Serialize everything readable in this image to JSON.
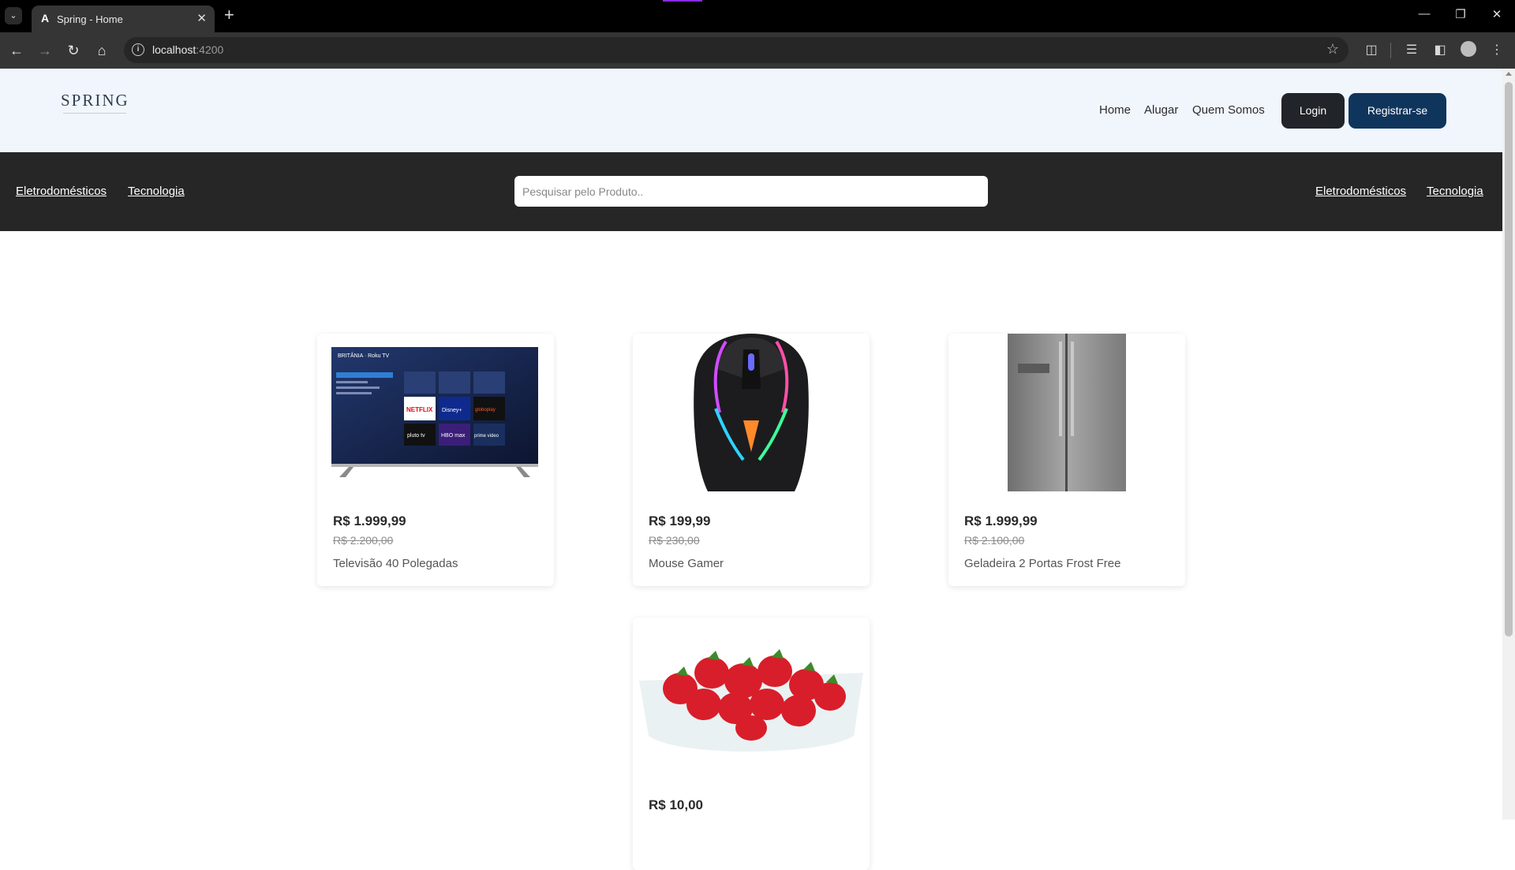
{
  "browser": {
    "tab_title": "Spring - Home",
    "tab_favicon": "A",
    "url_host": "localhost",
    "url_port": ":4200",
    "icons": [
      "tab-list-icon",
      "close-icon",
      "new-tab-icon",
      "minimize-icon",
      "restore-icon",
      "window-close-icon",
      "back-icon",
      "forward-icon",
      "reload-icon",
      "home-icon",
      "site-info-icon",
      "bookmark-star-icon",
      "extensions-icon",
      "media-icon",
      "side-panel-icon",
      "profile-icon",
      "menu-icon"
    ]
  },
  "header": {
    "logo": "SPRING",
    "nav": [
      "Home",
      "Alugar",
      "Quem Somos"
    ],
    "login_label": "Login",
    "register_label": "Registrar-se",
    "colors": {
      "background": "#f1f6fd",
      "login": "#212428",
      "register": "#10355c"
    }
  },
  "category_bar": {
    "left": [
      "Eletrodomésticos",
      "Tecnologia"
    ],
    "right": [
      "Eletrodomésticos",
      "Tecnologia"
    ],
    "search_placeholder": "Pesquisar pelo Produto..",
    "colors": {
      "background": "#262626"
    }
  },
  "products": [
    {
      "price": "R$ 1.999,99",
      "old_price": "R$ 2.200,00",
      "name": "Televisão 40 Polegadas",
      "image": "tv-image"
    },
    {
      "price": "R$ 199,99",
      "old_price": "R$ 230,00",
      "name": "Mouse Gamer",
      "image": "mouse-image"
    },
    {
      "price": "R$ 1.999,99",
      "old_price": "R$ 2.100,00",
      "name": "Geladeira 2 Portas Frost Free",
      "image": "fridge-image"
    },
    {
      "price": "R$ 10,00",
      "old_price": "",
      "name": "",
      "image": "strawberries-image"
    }
  ],
  "tv_screen": {
    "brand": "BRITÂNIA · Roku TV",
    "apps": [
      "NETFLIX",
      "Disney+",
      "globoplay",
      "pluto tv",
      "HBO max",
      "prime video"
    ]
  }
}
